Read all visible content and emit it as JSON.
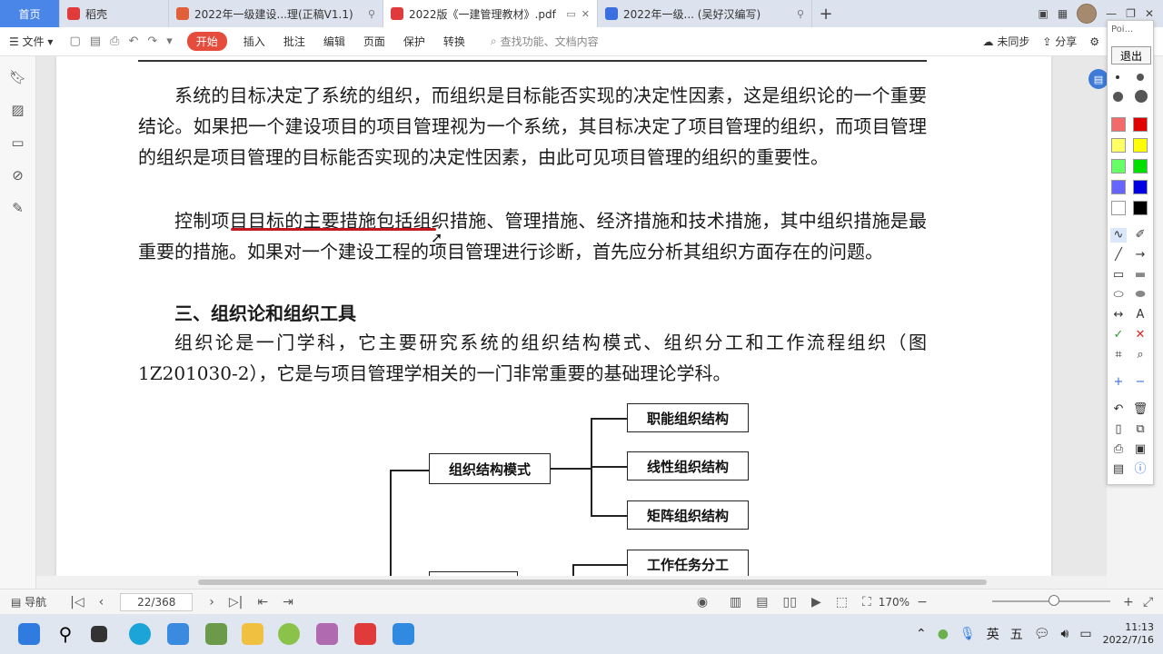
{
  "tabs": [
    {
      "label": "首页",
      "color": "#4a86e8"
    },
    {
      "label": "稻壳",
      "color": "#e03a3a"
    },
    {
      "label": "2022年一级建设...理(正稿V1.1)",
      "color": "#e0603a"
    },
    {
      "label": "2022版《一建管理教材》.pdf",
      "color": "#e03a3a"
    },
    {
      "label": "2022年一级... (吴好汉编写)",
      "color": "#3a6fe0"
    }
  ],
  "menubar": {
    "file": "文件",
    "start": "开始",
    "items": [
      "插入",
      "批注",
      "编辑",
      "页面",
      "保护",
      "转换"
    ],
    "search_placeholder": "查找功能、文档内容",
    "sync": "未同步",
    "share": "分享"
  },
  "document": {
    "paragraph1": "系统的目标决定了系统的组织，而组织是目标能否实现的决定性因素，这是组织论的一个重要结论。如果把一个建设项目的项目管理视为一个系统，其目标决定了项目管理的组织，而项目管理的组织是项目管理的目标能否实现的决定性因素，由此可见项目管理的组织的重要性。",
    "paragraph2": "控制项目目标的主要措施包括组织措施、管理措施、经济措施和技术措施，其中组织措施是最重要的措施。如果对一个建设工程的项目管理进行诊断，首先应分析其组织方面存在的问题。",
    "heading3": "三、组织论和组织工具",
    "paragraph3": "组织论是一门学科，它主要研究系统的组织结构模式、组织分工和工作流程组织（图 1Z201030-2），它是与项目管理学相关的一门非常重要的基础理论学科。",
    "diagram": {
      "center": "组织结构模式",
      "branches": [
        "职能组织结构",
        "线性组织结构",
        "矩阵组织结构"
      ],
      "next": "工作任务分工"
    }
  },
  "pen_toolbar": {
    "title": "Poi...",
    "exit": "退出",
    "colors": [
      "#f26b6b",
      "#e00000",
      "#ffff66",
      "#ffff00",
      "#66ff66",
      "#00e000",
      "#6666ff",
      "#0000e0",
      "#ffffff",
      "#000000"
    ]
  },
  "statusbar": {
    "nav": "导航",
    "page": "22/368",
    "zoom": "170%"
  },
  "taskbar": {
    "lang": "英",
    "ime": "五",
    "time": "11:13",
    "date": "2022/7/16"
  }
}
